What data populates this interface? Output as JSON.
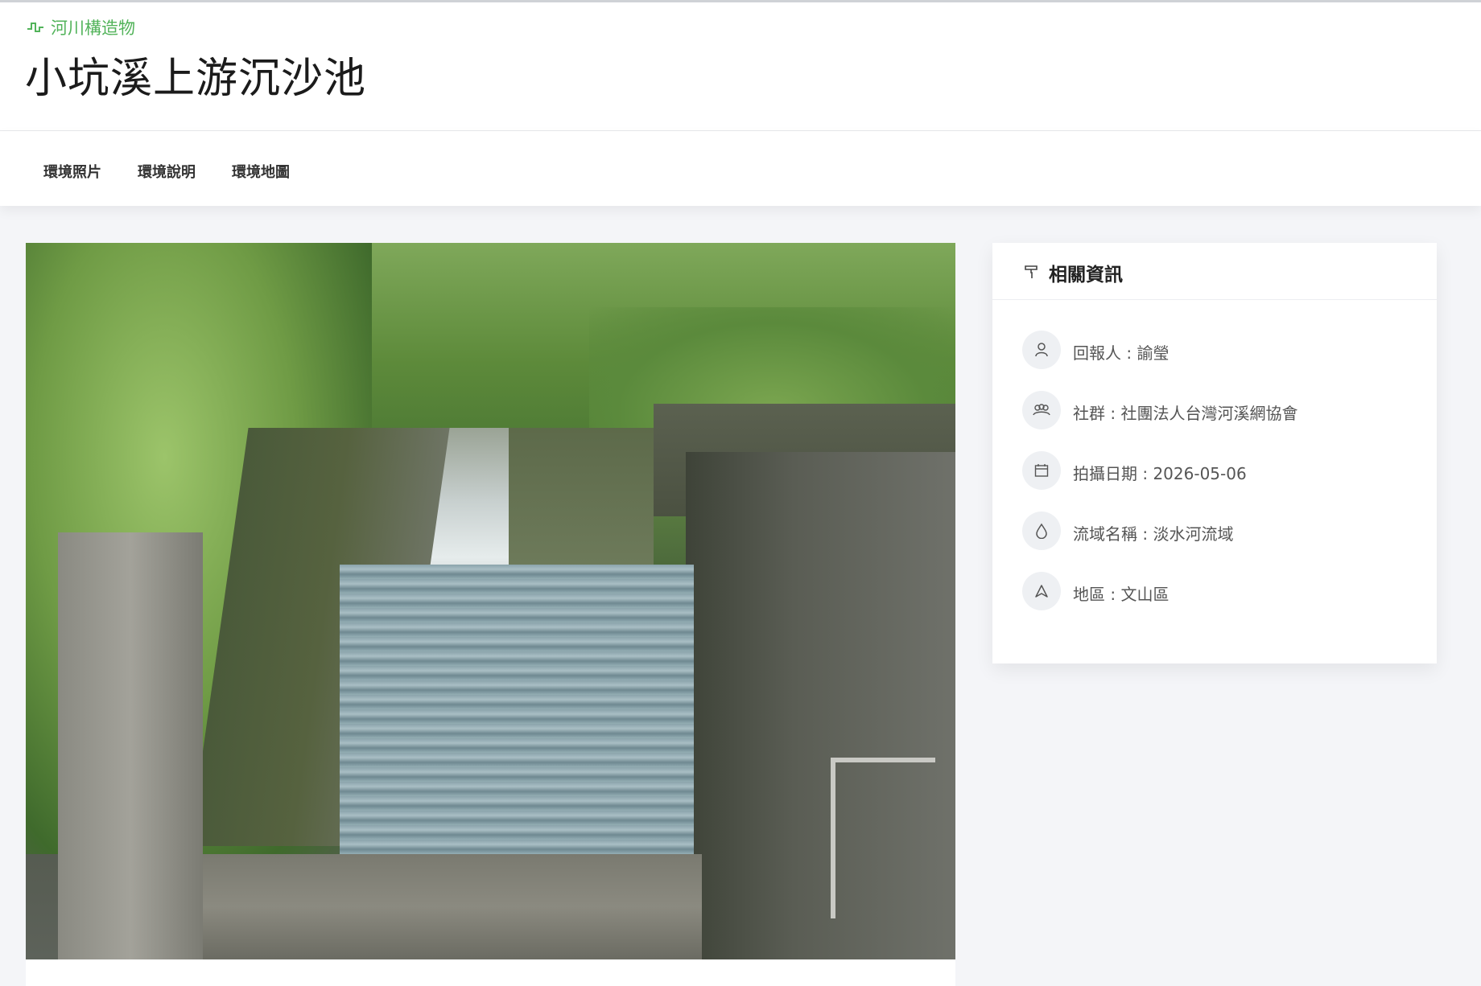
{
  "header": {
    "category": "河川構造物",
    "title": "小坑溪上游沉沙池"
  },
  "tabs": [
    {
      "label": "環境照片"
    },
    {
      "label": "環境說明"
    },
    {
      "label": "環境地圖"
    }
  ],
  "info": {
    "title": "相關資訊",
    "rows": [
      {
        "icon": "user-icon",
        "text": "回報人 : 諭瑩"
      },
      {
        "icon": "group-icon",
        "text": "社群 : 社團法人台灣河溪網協會"
      },
      {
        "icon": "calendar-icon",
        "text": "拍攝日期 : 2026-05-06"
      },
      {
        "icon": "water-drop-icon",
        "text": "流域名稱 : 淡水河流域"
      },
      {
        "icon": "location-arrow-icon",
        "text": "地區 : 文山區"
      }
    ]
  },
  "colors": {
    "accent": "#52b35a",
    "background": "#f4f5f8"
  }
}
